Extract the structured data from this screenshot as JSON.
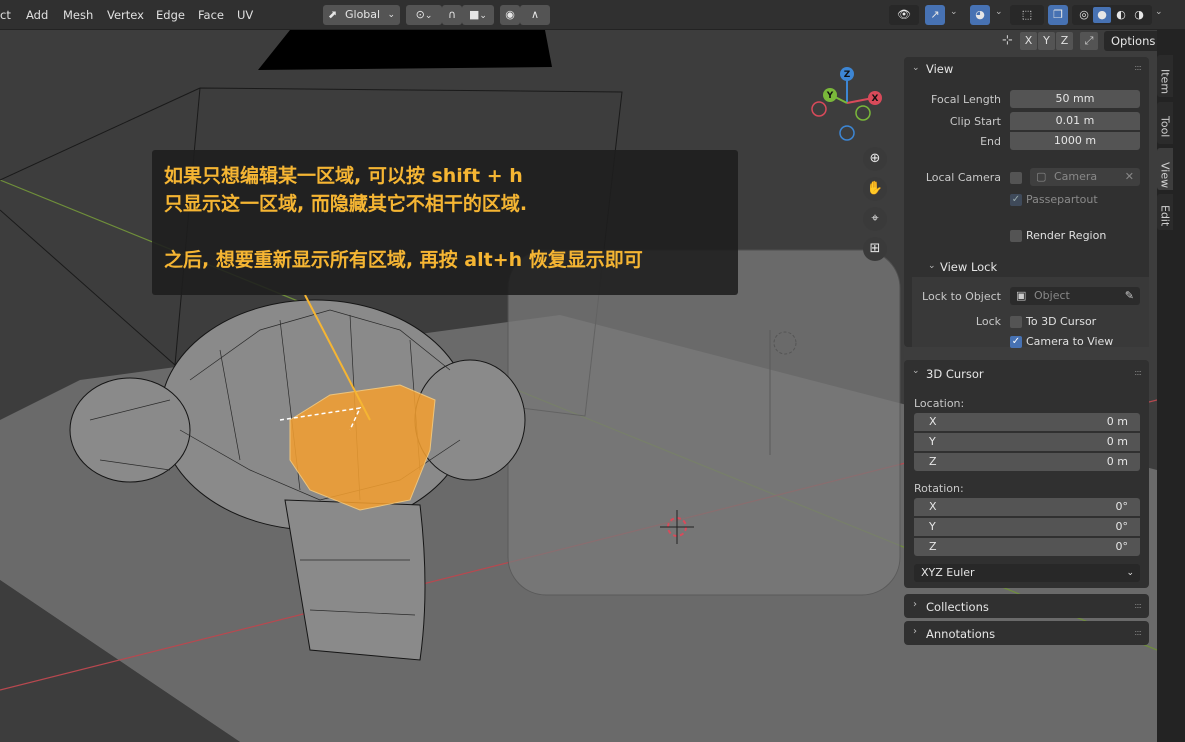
{
  "header": {
    "menus": [
      "ct",
      "Add",
      "Mesh",
      "Vertex",
      "Edge",
      "Face",
      "UV"
    ],
    "transform_orientation": "Global",
    "viewport_options": "Options",
    "axes": [
      "X",
      "Y",
      "Z"
    ]
  },
  "gizmo": {
    "x": "X",
    "y": "Y",
    "z": "Z"
  },
  "annotation": {
    "line1": "如果只想编辑某一区域, 可以按 shift + h",
    "line2": "只显示这一区域, 而隐藏其它不相干的区域.",
    "line3": "之后, 想要重新显示所有区域, 再按 alt+h 恢复显示即可",
    "color": "#f5b533"
  },
  "sidebar": {
    "tabs": [
      "Item",
      "Tool",
      "View",
      "Edit"
    ],
    "active_tab": "View",
    "view_panel": {
      "title": "View",
      "focal_length_label": "Focal Length",
      "focal_length": "50 mm",
      "clip_start_label": "Clip Start",
      "clip_start": "0.01 m",
      "end_label": "End",
      "end": "1000 m",
      "local_camera_label": "Local Camera",
      "camera_placeholder": "Camera",
      "passepartout": "Passepartout",
      "render_region": "Render Region"
    },
    "view_lock": {
      "title": "View Lock",
      "lock_to_object_label": "Lock to Object",
      "object_placeholder": "Object",
      "lock_label": "Lock",
      "to_3d_cursor": "To 3D Cursor",
      "camera_to_view": "Camera to View"
    },
    "cursor_panel": {
      "title": "3D Cursor",
      "location_label": "Location:",
      "location": [
        {
          "axis": "X",
          "value": "0 m"
        },
        {
          "axis": "Y",
          "value": "0 m"
        },
        {
          "axis": "Z",
          "value": "0 m"
        }
      ],
      "rotation_label": "Rotation:",
      "rotation": [
        {
          "axis": "X",
          "value": "0°"
        },
        {
          "axis": "Y",
          "value": "0°"
        },
        {
          "axis": "Z",
          "value": "0°"
        }
      ],
      "rotation_mode": "XYZ Euler"
    },
    "collections": "Collections",
    "annotations": "Annotations"
  },
  "colors": {
    "accent_blue": "#4772b3",
    "selection_orange": "#f5a030",
    "axis_x": "#d94a5a",
    "axis_y": "#7ab83a",
    "axis_z": "#3d86d4"
  }
}
